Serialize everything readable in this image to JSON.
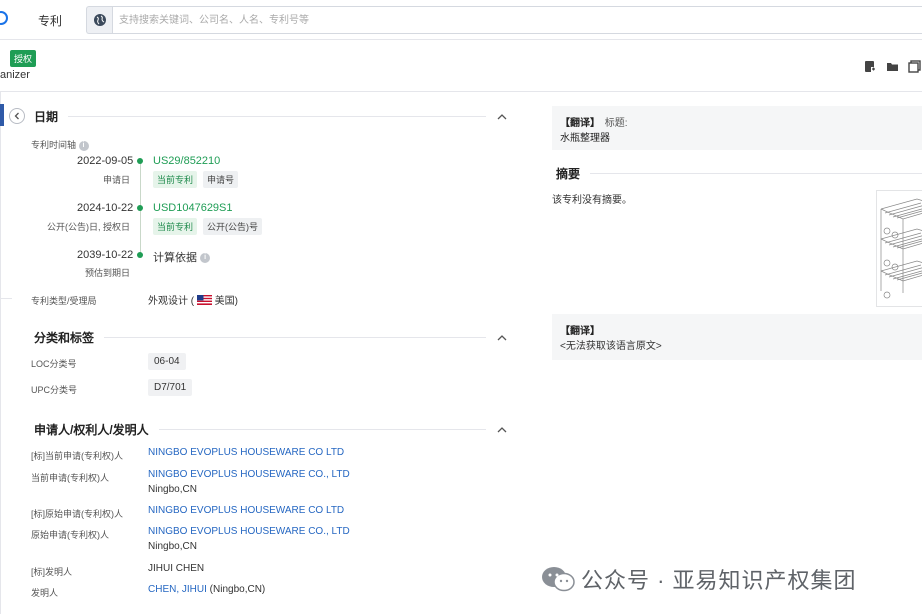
{
  "topbar": {
    "nav_label": "专利",
    "search_placeholder": "支持搜索关键词、公司名、人名、专利号等"
  },
  "title": {
    "status_badge": "授权",
    "title_fragment": "anizer"
  },
  "dates": {
    "section_title": "日期",
    "timeline_label": "专利时间轴",
    "events": [
      {
        "date": "2022-09-05",
        "type": "申请日",
        "number": "US29/852210",
        "tags": [
          "当前专利",
          "申请号"
        ]
      },
      {
        "date": "2024-10-22",
        "type": "公开(公告)日, 授权日",
        "number": "USD1047629S1",
        "tags": [
          "当前专利",
          "公开(公告)号"
        ]
      },
      {
        "date": "2039-10-22",
        "type": "预估到期日",
        "number": "计算依据",
        "tags": []
      }
    ],
    "type_label": "专利类型/受理局",
    "type_value": "外观设计 (",
    "country": "美国",
    "type_close": ")"
  },
  "classification": {
    "section_title": "分类和标签",
    "loc_label": "LOC分类号",
    "loc_value": "06-04",
    "upc_label": "UPC分类号",
    "upc_value": "D7/701"
  },
  "parties": {
    "section_title": "申请人/权利人/发明人",
    "rows": [
      {
        "label": "[标]当前申请(专利权)人",
        "value": "NINGBO EVOPLUS HOUSEWARE CO LTD",
        "sub": ""
      },
      {
        "label": "当前申请(专利权)人",
        "value": "NINGBO EVOPLUS HOUSEWARE CO., LTD",
        "sub": "Ningbo,CN"
      },
      {
        "label": "[标]原始申请(专利权)人",
        "value": "NINGBO EVOPLUS HOUSEWARE CO LTD",
        "sub": ""
      },
      {
        "label": "原始申请(专利权)人",
        "value": "NINGBO EVOPLUS HOUSEWARE CO., LTD",
        "sub": "Ningbo,CN"
      },
      {
        "label": "[标]发明人",
        "value": "JIHUI CHEN",
        "sub": ""
      },
      {
        "label": "发明人",
        "value": "CHEN, JIHUI",
        "sub": " (Ningbo,CN)"
      }
    ]
  },
  "right": {
    "translate_tag": "【翻译】",
    "title_label": "标题:",
    "title_value": "水瓶整理器",
    "summary_title": "摘要",
    "summary_text": "该专利没有摘要。",
    "translate_tag2": "【翻译】",
    "no_source": "<无法获取该语言原文>"
  },
  "watermark": {
    "text": "公众号 · 亚易知识产权集团"
  },
  "colors": {
    "accent": "#2567c2",
    "green": "#1f9d55",
    "nav_blue": "#2f5aa8"
  }
}
